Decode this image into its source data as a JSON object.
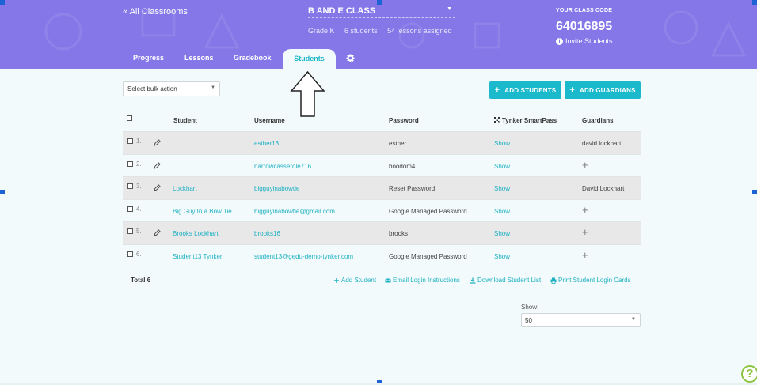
{
  "header": {
    "back_link": "« All Classrooms",
    "class_name": "B AND E CLASS",
    "grade": "Grade K",
    "students_count": "6 students",
    "lessons_assigned": "54 lessons assigned",
    "code_label": "YOUR CLASS CODE",
    "class_code": "64016895",
    "invite_label": "Invite Students"
  },
  "tabs": {
    "progress": "Progress",
    "lessons": "Lessons",
    "gradebook": "Gradebook",
    "students": "Students"
  },
  "toolbar": {
    "bulk_action_placeholder": "Select bulk action",
    "add_students": "ADD STUDENTS",
    "add_guardians": "ADD GUARDIANS"
  },
  "table": {
    "columns": {
      "student": "Student",
      "username": "Username",
      "password": "Password",
      "smartpass": "Tynker SmartPass",
      "guardians": "Guardians"
    },
    "rows": [
      {
        "num": "1.",
        "student": "",
        "username": "esther13",
        "password": "esther",
        "smartpass": "Show",
        "guardian": "david lockhart"
      },
      {
        "num": "2.",
        "student": "",
        "username": "narrowcasserole716",
        "password": "boodom4",
        "smartpass": "Show",
        "guardian": ""
      },
      {
        "num": "3.",
        "student": "Lockhart",
        "username": "bigguyinabowtie",
        "password": "Reset Password",
        "smartpass": "Show",
        "guardian": "David Lockhart"
      },
      {
        "num": "4.",
        "student": "Big Guy In a Bow Tie",
        "username": "bigguyinabowtie@gmail.com",
        "password": "Google Managed Password",
        "smartpass": "Show",
        "guardian": ""
      },
      {
        "num": "5.",
        "student": "Brooks Lockhart",
        "username": "brooks16",
        "password": "brooks",
        "smartpass": "Show",
        "guardian": ""
      },
      {
        "num": "6.",
        "student": "Student13 Tynker",
        "username": "student13@gedu-demo-tynker.com",
        "password": "Google Managed Password",
        "smartpass": "Show",
        "guardian": ""
      }
    ]
  },
  "footer": {
    "total": "Total 6",
    "add_student": "Add Student",
    "email_instructions": "Email Login Instructions",
    "download_list": "Download Student List",
    "print_cards": "Print Student Login Cards",
    "show_label": "Show:",
    "show_value": "50"
  },
  "colors": {
    "header_bg": "#8677e8",
    "accent": "#1bb9cc",
    "link": "#1eb1c2",
    "help": "#8cc63f"
  }
}
